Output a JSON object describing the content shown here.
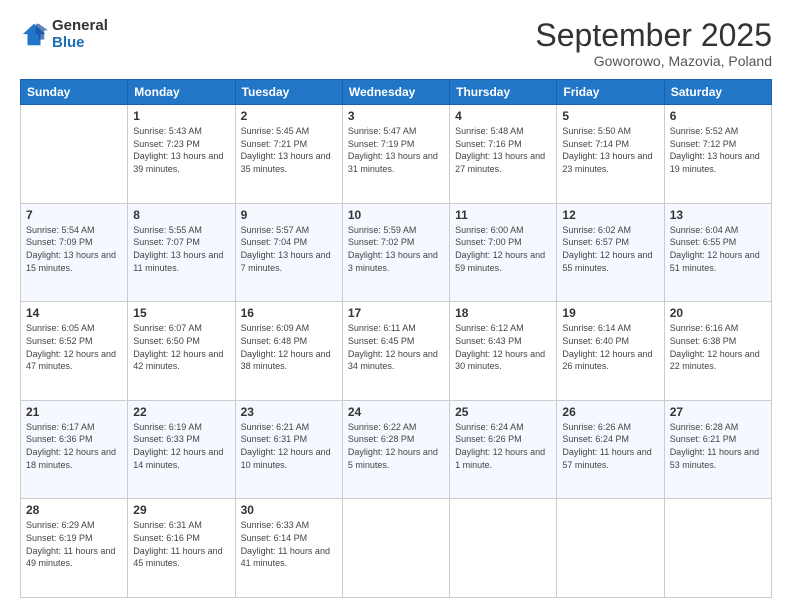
{
  "logo": {
    "general": "General",
    "blue": "Blue"
  },
  "title": {
    "month": "September 2025",
    "location": "Goworowo, Mazovia, Poland"
  },
  "header_days": [
    "Sunday",
    "Monday",
    "Tuesday",
    "Wednesday",
    "Thursday",
    "Friday",
    "Saturday"
  ],
  "weeks": [
    [
      {
        "day": "",
        "sunrise": "",
        "sunset": "",
        "daylight": ""
      },
      {
        "day": "1",
        "sunrise": "Sunrise: 5:43 AM",
        "sunset": "Sunset: 7:23 PM",
        "daylight": "Daylight: 13 hours and 39 minutes."
      },
      {
        "day": "2",
        "sunrise": "Sunrise: 5:45 AM",
        "sunset": "Sunset: 7:21 PM",
        "daylight": "Daylight: 13 hours and 35 minutes."
      },
      {
        "day": "3",
        "sunrise": "Sunrise: 5:47 AM",
        "sunset": "Sunset: 7:19 PM",
        "daylight": "Daylight: 13 hours and 31 minutes."
      },
      {
        "day": "4",
        "sunrise": "Sunrise: 5:48 AM",
        "sunset": "Sunset: 7:16 PM",
        "daylight": "Daylight: 13 hours and 27 minutes."
      },
      {
        "day": "5",
        "sunrise": "Sunrise: 5:50 AM",
        "sunset": "Sunset: 7:14 PM",
        "daylight": "Daylight: 13 hours and 23 minutes."
      },
      {
        "day": "6",
        "sunrise": "Sunrise: 5:52 AM",
        "sunset": "Sunset: 7:12 PM",
        "daylight": "Daylight: 13 hours and 19 minutes."
      }
    ],
    [
      {
        "day": "7",
        "sunrise": "Sunrise: 5:54 AM",
        "sunset": "Sunset: 7:09 PM",
        "daylight": "Daylight: 13 hours and 15 minutes."
      },
      {
        "day": "8",
        "sunrise": "Sunrise: 5:55 AM",
        "sunset": "Sunset: 7:07 PM",
        "daylight": "Daylight: 13 hours and 11 minutes."
      },
      {
        "day": "9",
        "sunrise": "Sunrise: 5:57 AM",
        "sunset": "Sunset: 7:04 PM",
        "daylight": "Daylight: 13 hours and 7 minutes."
      },
      {
        "day": "10",
        "sunrise": "Sunrise: 5:59 AM",
        "sunset": "Sunset: 7:02 PM",
        "daylight": "Daylight: 13 hours and 3 minutes."
      },
      {
        "day": "11",
        "sunrise": "Sunrise: 6:00 AM",
        "sunset": "Sunset: 7:00 PM",
        "daylight": "Daylight: 12 hours and 59 minutes."
      },
      {
        "day": "12",
        "sunrise": "Sunrise: 6:02 AM",
        "sunset": "Sunset: 6:57 PM",
        "daylight": "Daylight: 12 hours and 55 minutes."
      },
      {
        "day": "13",
        "sunrise": "Sunrise: 6:04 AM",
        "sunset": "Sunset: 6:55 PM",
        "daylight": "Daylight: 12 hours and 51 minutes."
      }
    ],
    [
      {
        "day": "14",
        "sunrise": "Sunrise: 6:05 AM",
        "sunset": "Sunset: 6:52 PM",
        "daylight": "Daylight: 12 hours and 47 minutes."
      },
      {
        "day": "15",
        "sunrise": "Sunrise: 6:07 AM",
        "sunset": "Sunset: 6:50 PM",
        "daylight": "Daylight: 12 hours and 42 minutes."
      },
      {
        "day": "16",
        "sunrise": "Sunrise: 6:09 AM",
        "sunset": "Sunset: 6:48 PM",
        "daylight": "Daylight: 12 hours and 38 minutes."
      },
      {
        "day": "17",
        "sunrise": "Sunrise: 6:11 AM",
        "sunset": "Sunset: 6:45 PM",
        "daylight": "Daylight: 12 hours and 34 minutes."
      },
      {
        "day": "18",
        "sunrise": "Sunrise: 6:12 AM",
        "sunset": "Sunset: 6:43 PM",
        "daylight": "Daylight: 12 hours and 30 minutes."
      },
      {
        "day": "19",
        "sunrise": "Sunrise: 6:14 AM",
        "sunset": "Sunset: 6:40 PM",
        "daylight": "Daylight: 12 hours and 26 minutes."
      },
      {
        "day": "20",
        "sunrise": "Sunrise: 6:16 AM",
        "sunset": "Sunset: 6:38 PM",
        "daylight": "Daylight: 12 hours and 22 minutes."
      }
    ],
    [
      {
        "day": "21",
        "sunrise": "Sunrise: 6:17 AM",
        "sunset": "Sunset: 6:36 PM",
        "daylight": "Daylight: 12 hours and 18 minutes."
      },
      {
        "day": "22",
        "sunrise": "Sunrise: 6:19 AM",
        "sunset": "Sunset: 6:33 PM",
        "daylight": "Daylight: 12 hours and 14 minutes."
      },
      {
        "day": "23",
        "sunrise": "Sunrise: 6:21 AM",
        "sunset": "Sunset: 6:31 PM",
        "daylight": "Daylight: 12 hours and 10 minutes."
      },
      {
        "day": "24",
        "sunrise": "Sunrise: 6:22 AM",
        "sunset": "Sunset: 6:28 PM",
        "daylight": "Daylight: 12 hours and 5 minutes."
      },
      {
        "day": "25",
        "sunrise": "Sunrise: 6:24 AM",
        "sunset": "Sunset: 6:26 PM",
        "daylight": "Daylight: 12 hours and 1 minute."
      },
      {
        "day": "26",
        "sunrise": "Sunrise: 6:26 AM",
        "sunset": "Sunset: 6:24 PM",
        "daylight": "Daylight: 11 hours and 57 minutes."
      },
      {
        "day": "27",
        "sunrise": "Sunrise: 6:28 AM",
        "sunset": "Sunset: 6:21 PM",
        "daylight": "Daylight: 11 hours and 53 minutes."
      }
    ],
    [
      {
        "day": "28",
        "sunrise": "Sunrise: 6:29 AM",
        "sunset": "Sunset: 6:19 PM",
        "daylight": "Daylight: 11 hours and 49 minutes."
      },
      {
        "day": "29",
        "sunrise": "Sunrise: 6:31 AM",
        "sunset": "Sunset: 6:16 PM",
        "daylight": "Daylight: 11 hours and 45 minutes."
      },
      {
        "day": "30",
        "sunrise": "Sunrise: 6:33 AM",
        "sunset": "Sunset: 6:14 PM",
        "daylight": "Daylight: 11 hours and 41 minutes."
      },
      {
        "day": "",
        "sunrise": "",
        "sunset": "",
        "daylight": ""
      },
      {
        "day": "",
        "sunrise": "",
        "sunset": "",
        "daylight": ""
      },
      {
        "day": "",
        "sunrise": "",
        "sunset": "",
        "daylight": ""
      },
      {
        "day": "",
        "sunrise": "",
        "sunset": "",
        "daylight": ""
      }
    ]
  ]
}
